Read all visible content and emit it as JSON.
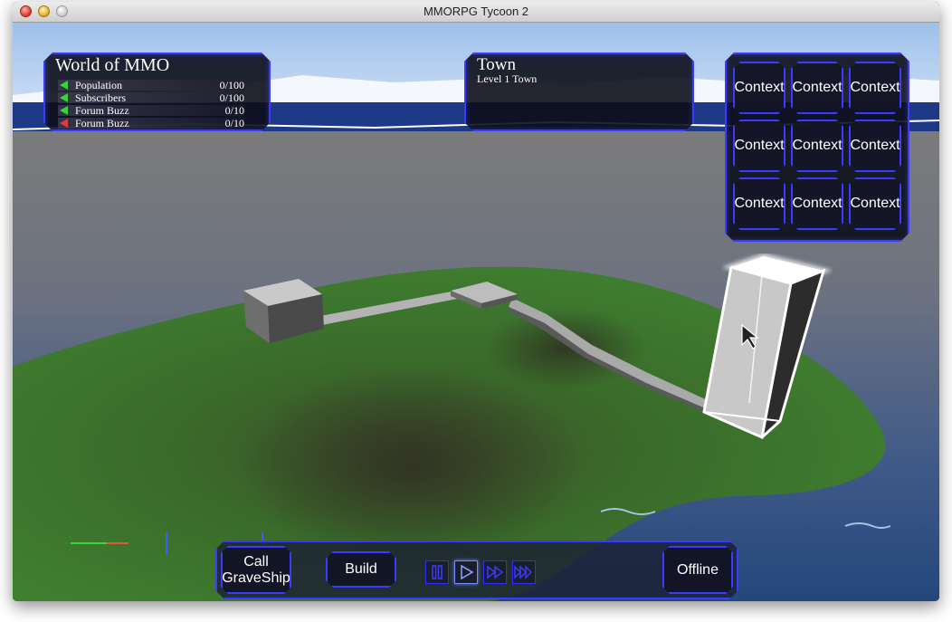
{
  "window": {
    "title": "MMORPG Tycoon 2"
  },
  "world_panel": {
    "title": "World of MMO",
    "stats": [
      {
        "label": "Population",
        "value": "0/100",
        "trend": "up",
        "color": "#39d23a"
      },
      {
        "label": "Subscribers",
        "value": "0/100",
        "trend": "up",
        "color": "#39d23a"
      },
      {
        "label": "Forum Buzz",
        "value": "0/10",
        "trend": "up",
        "color": "#39d23a"
      },
      {
        "label": "Forum Buzz",
        "value": "0/10",
        "trend": "down",
        "color": "#e33a3a"
      }
    ]
  },
  "town_panel": {
    "title": "Town",
    "subtitle": "Level 1 Town"
  },
  "context_panel": {
    "buttons": [
      "Context",
      "Context",
      "Context",
      "Context",
      "Context",
      "Context",
      "Context",
      "Context",
      "Context"
    ]
  },
  "bottom_bar": {
    "call_graveship_line1": "Call",
    "call_graveship_line2": "GraveShip",
    "build_label": "Build",
    "offline_label": "Offline",
    "speed_controls": [
      {
        "icon": "pause-icon",
        "active": false
      },
      {
        "icon": "play-icon",
        "active": true
      },
      {
        "icon": "fast-forward-icon",
        "active": false
      },
      {
        "icon": "fastest-forward-icon",
        "active": false
      }
    ]
  },
  "colors": {
    "hud_border": "#3b3bff",
    "hud_bg": "#0c0e1a",
    "grass": "#3f7a2c",
    "sky": "#6e8fc6"
  }
}
